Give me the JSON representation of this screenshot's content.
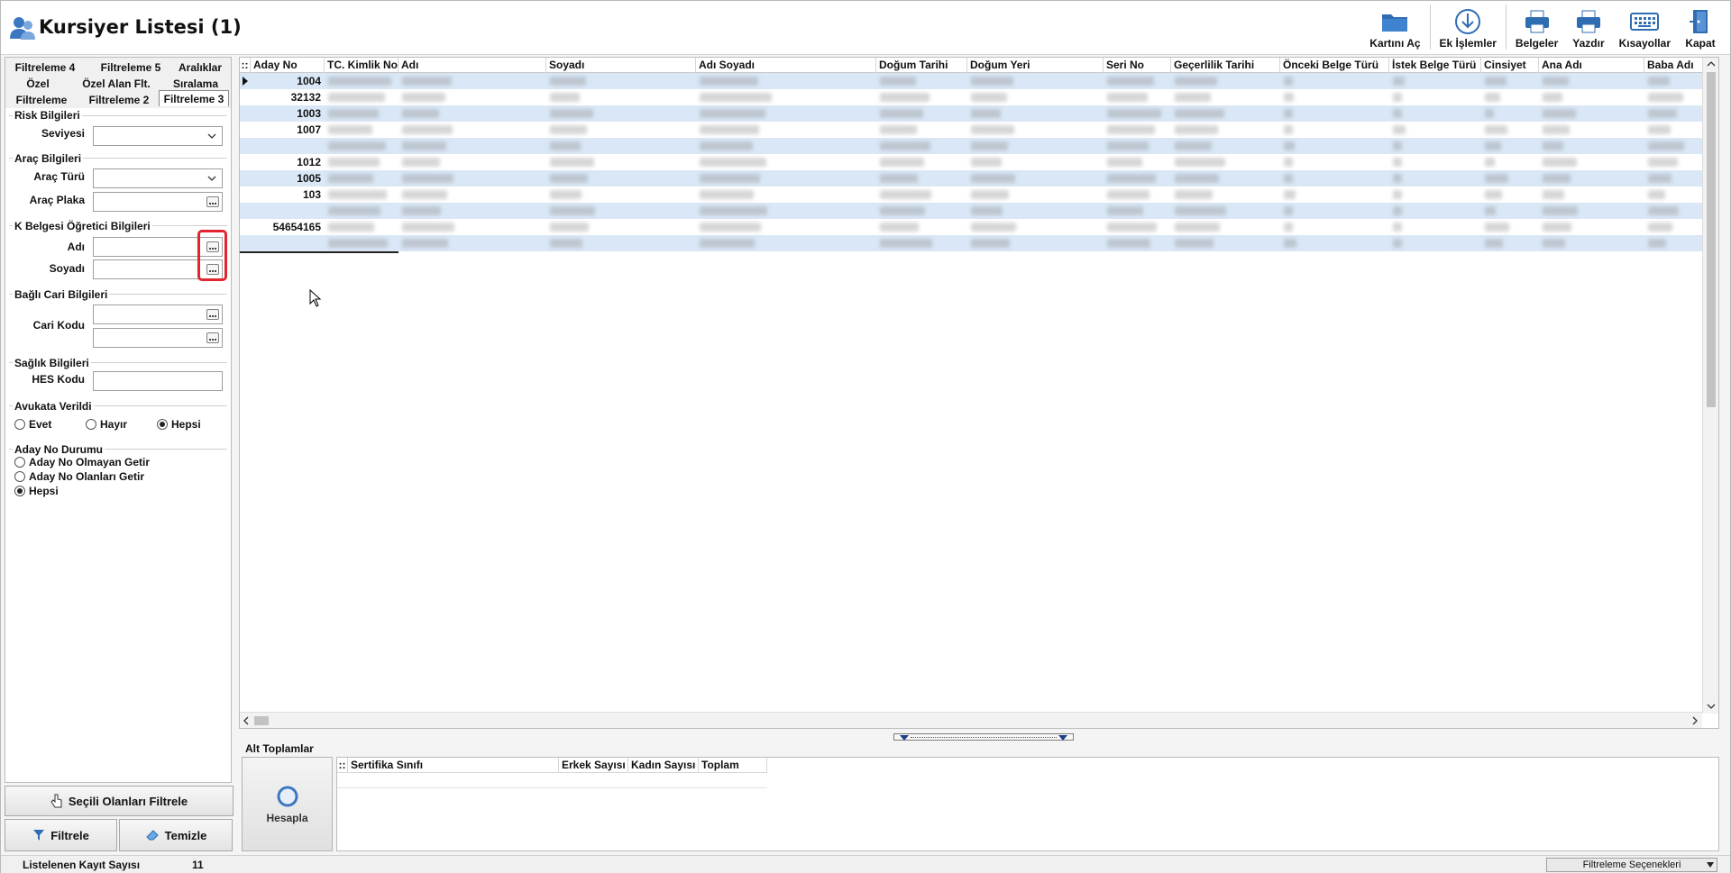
{
  "window": {
    "title": "Kursiyer Listesi (1)"
  },
  "toolbar": {
    "buttons": [
      {
        "label": "Kartını Aç",
        "icon": "folder-icon"
      },
      {
        "label": "Ek İşlemler",
        "icon": "download-circle-icon"
      },
      {
        "label": "Belgeler",
        "icon": "printer-icon"
      },
      {
        "label": "Yazdır",
        "icon": "printer-icon"
      },
      {
        "label": "Kısayollar",
        "icon": "keyboard-icon"
      },
      {
        "label": "Kapat",
        "icon": "exit-door-icon"
      }
    ]
  },
  "filter_tabs": [
    "Filtreleme 4",
    "Filtreleme 5",
    "Aralıklar",
    "Özel",
    "Özel Alan Flt.",
    "Sıralama",
    "Filtreleme",
    "Filtreleme 2",
    "Filtreleme 3"
  ],
  "active_tab": "Filtreleme 3",
  "filters": {
    "risk": {
      "title": "Risk Bilgileri",
      "seviyesi_label": "Seviyesi",
      "seviyesi_value": ""
    },
    "arac": {
      "title": "Araç Bilgileri",
      "turu_label": "Araç Türü",
      "turu_value": "",
      "plaka_label": "Araç Plaka",
      "plaka_value": ""
    },
    "ogretici": {
      "title": "K Belgesi Öğretici Bilgileri",
      "adi_label": "Adı",
      "adi_value": "",
      "soyadi_label": "Soyadı",
      "soyadi_value": ""
    },
    "cari": {
      "title": "Bağlı Cari Bilgileri",
      "kodu_label": "Cari Kodu",
      "kodu_value1": "",
      "kodu_value2": ""
    },
    "saglik": {
      "title": "Sağlık Bilgileri",
      "hes_label": "HES Kodu",
      "hes_value": ""
    },
    "avukat": {
      "title": "Avukata Verildi",
      "options": [
        "Evet",
        "Hayır",
        "Hepsi"
      ],
      "selected": "Hepsi"
    },
    "aday_durum": {
      "title": "Aday No Durumu",
      "options": [
        "Aday No Olmayan Getir",
        "Aday No Olanları Getir",
        "Hepsi"
      ],
      "selected": "Hepsi"
    }
  },
  "left_buttons": {
    "secili": "Seçili Olanları Filtrele",
    "filtrele": "Filtrele",
    "temizle": "Temizle"
  },
  "grid": {
    "columns": [
      "Aday No",
      "TC. Kimlik No",
      "Adı",
      "Soyadı",
      "Adı Soyadı",
      "Doğum Tarihi",
      "Doğum Yeri",
      "Seri No",
      "Geçerlilik Tarihi",
      "Önceki Belge Türü",
      "İstek Belge Türü",
      "Cinsiyet",
      "Ana Adı",
      "Baba Adı"
    ],
    "aday_no_values": [
      "1004",
      "32132",
      "1003",
      "1007",
      "",
      "1012",
      "1005",
      "103",
      "",
      "54654165",
      ""
    ]
  },
  "totals": {
    "title": "Alt Toplamlar",
    "calc_button": "Hesapla",
    "columns": [
      "Sertifika Sınıfı",
      "Erkek Sayısı",
      "Kadın Sayısı",
      "Toplam"
    ]
  },
  "status": {
    "record_label": "Listelenen Kayıt Sayısı",
    "record_count": "11",
    "filter_options": "Filtreleme Seçenekleri"
  },
  "colors": {
    "row_alt": "#d9e7f6",
    "highlight": "#e0252f",
    "icon_blue": "#2f6db3"
  }
}
